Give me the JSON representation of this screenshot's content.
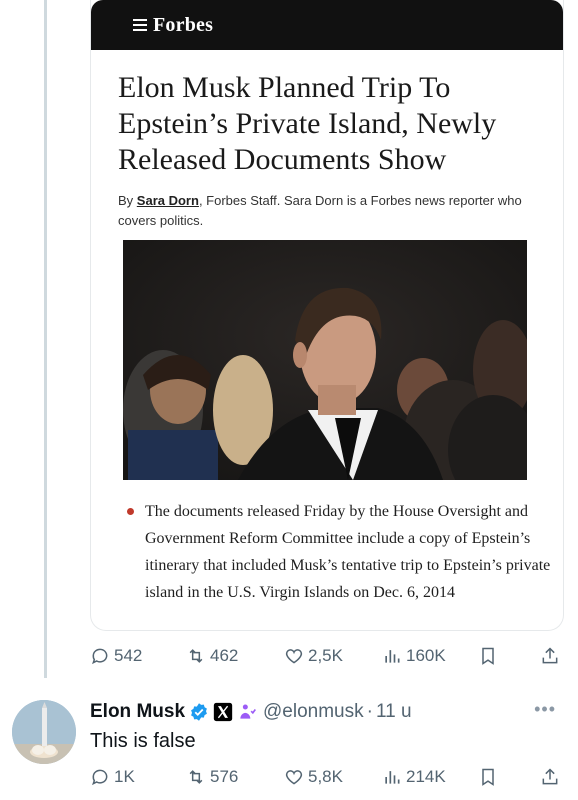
{
  "article": {
    "publication": "Forbes",
    "headline": "Elon Musk Planned Trip To Epstein’s Private Island, Newly Released Documents Show",
    "byline_prefix": "By ",
    "author": "Sara Dorn",
    "byline_suffix": ", Forbes Staff.  Sara Dorn is a Forbes news reporter who covers politics.",
    "bullet": "The documents released Friday by the House Oversight and Government Reform Committee include a copy of Epstein’s itinerary that included Musk’s tentative trip to Epstein’s private island in the U.S. Virgin Islands on Dec. 6, 2014"
  },
  "post_actions": {
    "replies": "542",
    "reposts": "462",
    "likes": "2,5K",
    "views": "160K"
  },
  "reply": {
    "name": "Elon Musk",
    "handle": "@elonmusk",
    "separator": "·",
    "time": "11 u",
    "text": "This is false",
    "more": "•••",
    "replies": "1K",
    "reposts": "576",
    "likes": "5,8K",
    "views": "214K"
  },
  "colors": {
    "verified_blue": "#1d9bf0",
    "muted_text": "#536471",
    "bullet_red": "#c0392b",
    "forbes_bar": "#111111",
    "affiliate_badge": "#9c5cf6"
  },
  "icons": [
    "menu-icon",
    "reply-icon",
    "repost-icon",
    "like-icon",
    "views-icon",
    "bookmark-icon",
    "share-icon",
    "verified-badge-icon",
    "x-affiliate-icon",
    "accessibility-badge-icon"
  ]
}
